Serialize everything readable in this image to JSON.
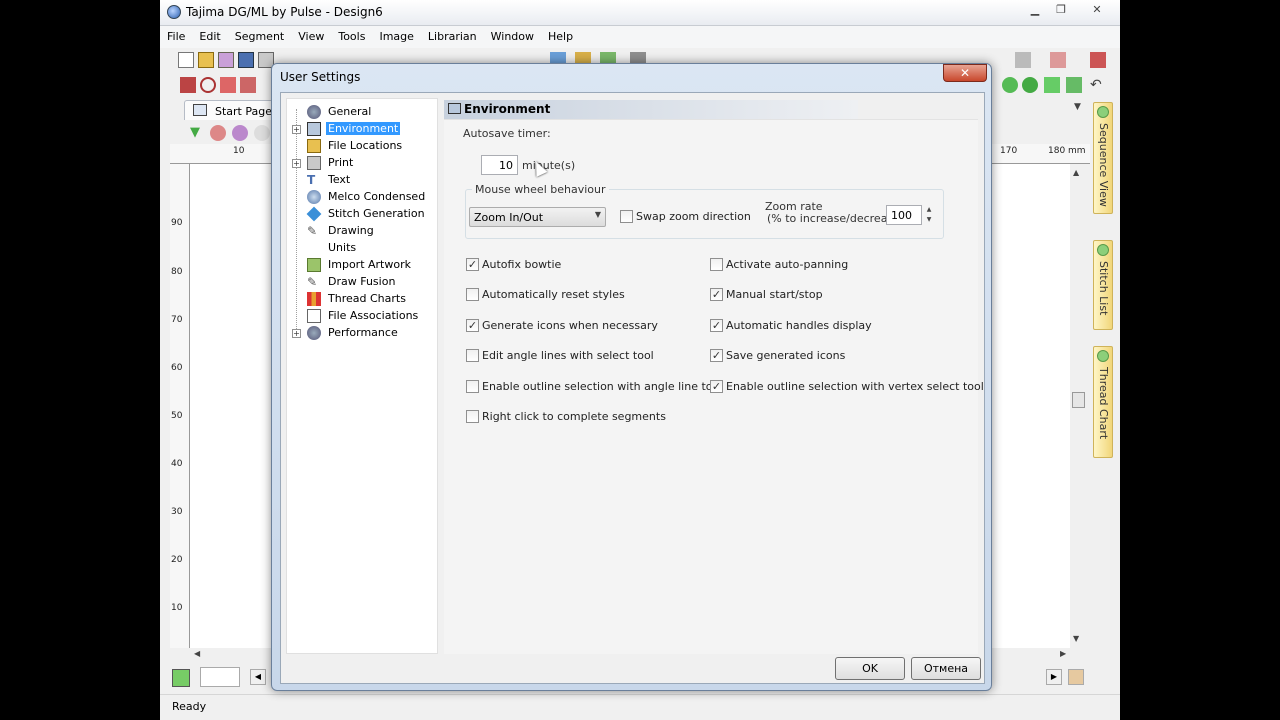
{
  "app": {
    "title": "Tajima DG/ML by Pulse - Design6",
    "menu": [
      "File",
      "Edit",
      "Segment",
      "View",
      "Tools",
      "Image",
      "Librarian",
      "Window",
      "Help"
    ],
    "start_tab": "Start Page",
    "status": "Ready",
    "ruler_top": [
      "10",
      "170",
      "180 mm"
    ],
    "ruler_left": [
      "90",
      "80",
      "70",
      "60",
      "50",
      "40",
      "30",
      "20",
      "10"
    ],
    "side_tabs": [
      "Sequence View",
      "Stitch List",
      "Thread Chart"
    ]
  },
  "dialog": {
    "title": "User Settings",
    "close": "✕",
    "tree": [
      {
        "label": "General",
        "expandable": false,
        "selected": false
      },
      {
        "label": "Environment",
        "expandable": true,
        "selected": true
      },
      {
        "label": "File Locations",
        "expandable": false,
        "selected": false
      },
      {
        "label": "Print",
        "expandable": true,
        "selected": false
      },
      {
        "label": "Text",
        "expandable": false,
        "selected": false
      },
      {
        "label": "Melco Condensed",
        "expandable": false,
        "selected": false
      },
      {
        "label": "Stitch Generation",
        "expandable": false,
        "selected": false
      },
      {
        "label": "Drawing",
        "expandable": false,
        "selected": false
      },
      {
        "label": "Units",
        "expandable": false,
        "selected": false
      },
      {
        "label": "Import Artwork",
        "expandable": false,
        "selected": false
      },
      {
        "label": "Draw Fusion",
        "expandable": false,
        "selected": false
      },
      {
        "label": "Thread Charts",
        "expandable": false,
        "selected": false
      },
      {
        "label": "File Associations",
        "expandable": false,
        "selected": false
      },
      {
        "label": "Performance",
        "expandable": true,
        "selected": false
      }
    ],
    "section_title": "Environment",
    "autosave_label": "Autosave timer:",
    "autosave_value": "10",
    "autosave_unit": "minute(s)",
    "mouse_wheel_title": "Mouse wheel behaviour",
    "mouse_wheel_value": "Zoom In/Out",
    "swap_zoom_label": "Swap zoom direction",
    "zoom_rate_label_1": "Zoom rate",
    "zoom_rate_label_2": "(% to increase/decrease):",
    "zoom_rate_value": "100",
    "options_left": [
      {
        "label": "Autofix bowtie",
        "checked": true
      },
      {
        "label": "Automatically reset styles",
        "checked": false
      },
      {
        "label": "Generate icons when necessary",
        "checked": true
      },
      {
        "label": "Edit angle lines with select tool",
        "checked": false
      },
      {
        "label": "Enable outline selection with angle line tool",
        "checked": false
      },
      {
        "label": "Right click to complete segments",
        "checked": false
      }
    ],
    "options_right": [
      {
        "label": "Activate auto-panning",
        "checked": false
      },
      {
        "label": "Manual start/stop",
        "checked": true
      },
      {
        "label": "Automatic handles display",
        "checked": true
      },
      {
        "label": "Save generated icons",
        "checked": true
      },
      {
        "label": "Enable outline selection with vertex select tool",
        "checked": true
      }
    ],
    "ok_label": "OK",
    "cancel_label": "Отмена"
  },
  "colors": {
    "selection": "#3399ff",
    "dialog_frame": "#c8d7ea",
    "close_button": "#c8472c",
    "side_tab": "#f1d67a"
  }
}
